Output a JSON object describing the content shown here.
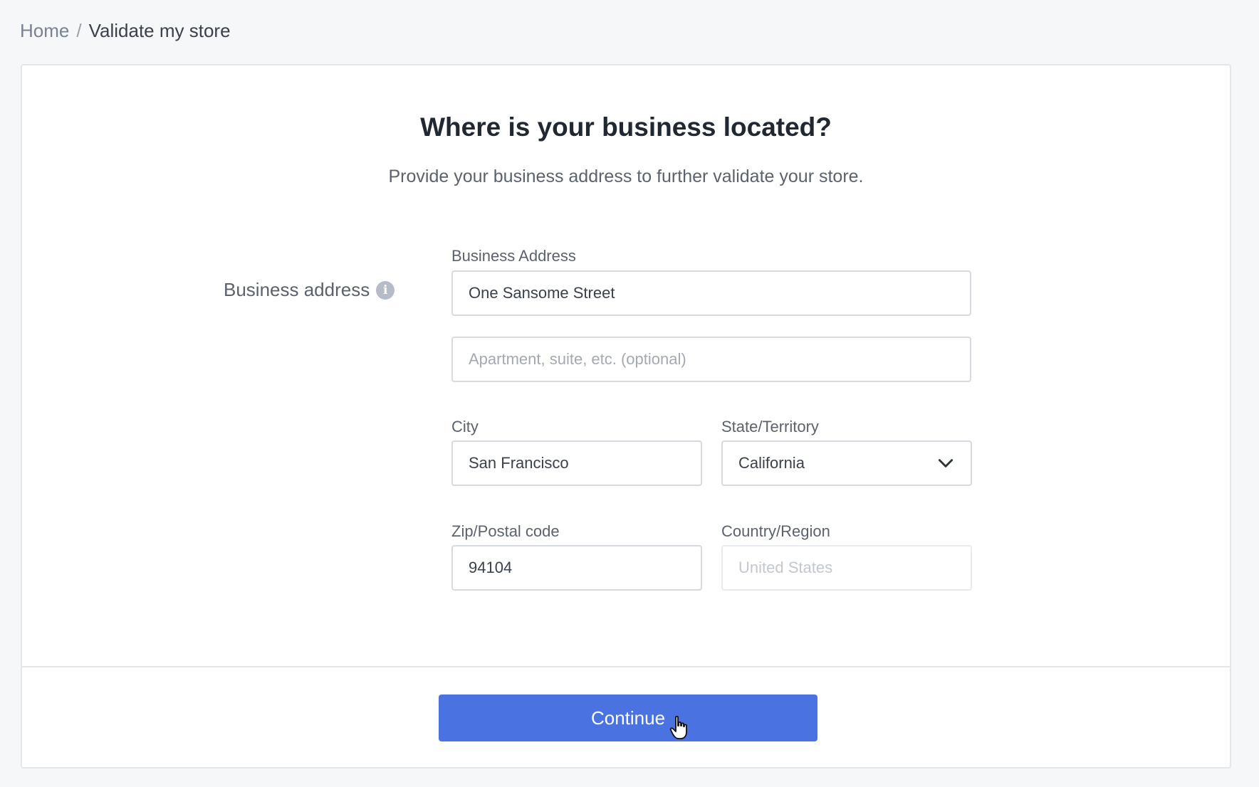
{
  "breadcrumb": {
    "home": "Home",
    "separator": "/",
    "current": "Validate my store"
  },
  "page": {
    "title": "Where is your business located?",
    "subtitle": "Provide your business address to further validate your store."
  },
  "section": {
    "label": "Business address",
    "info_icon": "info-icon"
  },
  "form": {
    "address_label": "Business Address",
    "address_value": "One Sansome Street",
    "address2_placeholder": "Apartment, suite, etc. (optional)",
    "city_label": "City",
    "city_value": "San Francisco",
    "state_label": "State/Territory",
    "state_value": "California",
    "zip_label": "Zip/Postal code",
    "zip_value": "94104",
    "country_label": "Country/Region",
    "country_placeholder": "United States"
  },
  "actions": {
    "continue_label": "Continue"
  },
  "colors": {
    "primary": "#4a72e0",
    "background": "#f6f7f9"
  }
}
